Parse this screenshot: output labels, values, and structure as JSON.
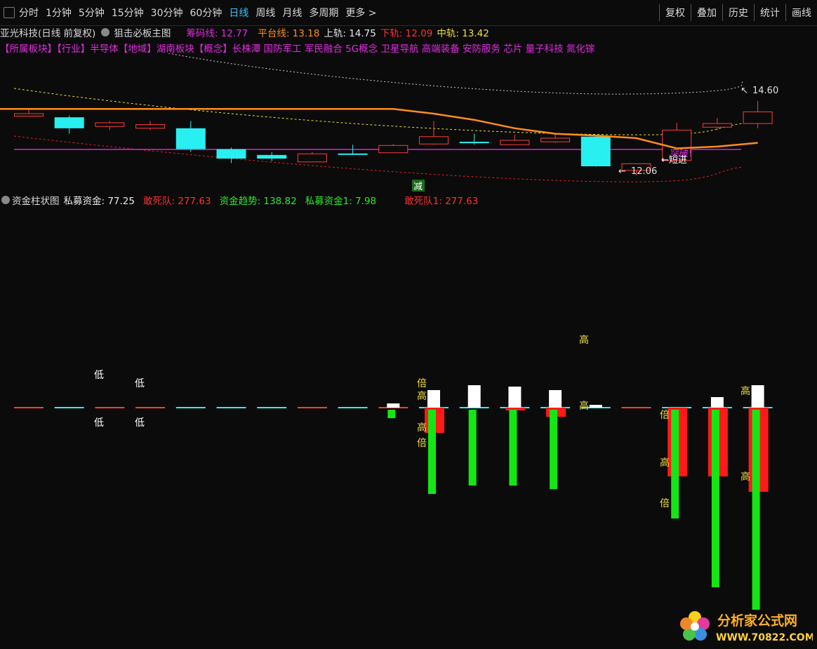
{
  "toolbar": {
    "periods": [
      "分时",
      "1分钟",
      "5分钟",
      "15分钟",
      "30分钟",
      "60分钟",
      "日线",
      "周线",
      "月线",
      "多周期",
      "更多 >"
    ],
    "active_period": "日线",
    "right_buttons": [
      "复权",
      "叠加",
      "历史",
      "统计",
      "画线"
    ]
  },
  "main_header": {
    "stock": "亚光科技(日线 前复权)",
    "indicator": "狙击必板主图",
    "chouma_label": "筹码线: 12.77",
    "pingtai_label": "平台线: 13.18",
    "shanggui_label": "上轨: 14.75",
    "xiagui_label": "下轨: 12.09",
    "zhonggui_label": "中轨: 13.42"
  },
  "blocks": [
    "【所属板块】【行业】半导体【地域】湖南板块【概念】长株潭 国防军工 军民融合 5G概念 卫星导航 高端装备 安防服务 芯片 量子科技 氮化镓"
  ],
  "sub_header": {
    "title": "资金柱状图",
    "simu_label": "私募资金: 77.25",
    "gansidui_label": "敢死队: 277.63",
    "qushi_label": "资金趋势: 138.82",
    "simu1_label": "私募资金1: 7.98",
    "gansidui1_label": "敢死队1: 277.63"
  },
  "chart_data": [
    {
      "type": "candlestick",
      "title": "",
      "price_range": [
        11.6,
        15.4
      ],
      "candles": [
        {
          "o": 13.75,
          "h": 13.85,
          "l": 13.7,
          "c": 13.68,
          "color": "red"
        },
        {
          "o": 13.65,
          "h": 13.7,
          "l": 13.2,
          "c": 13.35,
          "color": "cyan"
        },
        {
          "o": 13.4,
          "h": 13.55,
          "l": 13.3,
          "c": 13.5,
          "color": "red"
        },
        {
          "o": 13.35,
          "h": 13.55,
          "l": 13.3,
          "c": 13.45,
          "color": "red"
        },
        {
          "o": 13.35,
          "h": 13.55,
          "l": 12.7,
          "c": 12.78,
          "color": "cyan"
        },
        {
          "o": 12.78,
          "h": 12.82,
          "l": 12.4,
          "c": 12.52,
          "color": "cyan"
        },
        {
          "o": 12.62,
          "h": 12.7,
          "l": 12.45,
          "c": 12.52,
          "color": "cyan"
        },
        {
          "o": 12.43,
          "h": 12.7,
          "l": 12.43,
          "c": 12.65,
          "color": "red"
        },
        {
          "o": 12.66,
          "h": 12.9,
          "l": 12.62,
          "c": 12.66,
          "color": "cyan"
        },
        {
          "o": 12.68,
          "h": 12.92,
          "l": 12.68,
          "c": 12.88,
          "color": "red"
        },
        {
          "o": 12.92,
          "h": 13.55,
          "l": 12.9,
          "c": 13.12,
          "color": "red"
        },
        {
          "o": 12.98,
          "h": 13.2,
          "l": 12.9,
          "c": 12.95,
          "color": "cyan"
        },
        {
          "o": 12.9,
          "h": 13.18,
          "l": 12.9,
          "c": 13.02,
          "color": "red"
        },
        {
          "o": 12.98,
          "h": 13.2,
          "l": 12.95,
          "c": 13.08,
          "color": "red"
        },
        {
          "o": 13.12,
          "h": 13.12,
          "l": 12.3,
          "c": 12.31,
          "color": "cyan"
        },
        {
          "o": 12.2,
          "h": 12.38,
          "l": 12.06,
          "c": 12.38,
          "color": "red"
        },
        {
          "o": 12.47,
          "h": 13.5,
          "l": 12.47,
          "c": 13.3,
          "color": "red"
        },
        {
          "o": 13.38,
          "h": 13.63,
          "l": 13.3,
          "c": 13.48,
          "color": "red"
        },
        {
          "o": 13.48,
          "h": 14.1,
          "l": 13.35,
          "c": 13.8,
          "color": "red"
        }
      ],
      "lines": {
        "platform": [
          13.88,
          13.88,
          13.88,
          13.88,
          13.88,
          13.88,
          13.88,
          13.88,
          13.88,
          13.88,
          13.75,
          13.58,
          13.35,
          13.2,
          13.15,
          13.08,
          12.8,
          12.85,
          12.95
        ],
        "chouma": 12.77
      },
      "annotations": [
        "14.60",
        "12.06",
        "减",
        "突破!",
        "短进"
      ]
    },
    {
      "type": "bar",
      "title": "",
      "series": [
        {
          "name": "私募资金",
          "values": [
            0,
            0,
            0,
            0,
            0,
            0,
            0,
            0,
            0,
            6,
            25,
            32,
            30,
            25,
            4,
            0,
            0,
            15,
            32
          ]
        },
        {
          "name": "敢死队",
          "values": [
            0,
            0,
            0,
            0,
            0,
            0,
            0,
            0,
            0,
            0,
            -36,
            0,
            -4,
            -13,
            0,
            0,
            -98,
            -98,
            -120
          ]
        },
        {
          "name": "私募资金1",
          "values": [
            0,
            0,
            0,
            0,
            0,
            0,
            0,
            0,
            0,
            -12,
            -120,
            -108,
            -108,
            -113,
            0,
            0,
            -155,
            -253,
            -285
          ]
        }
      ],
      "markers": [
        "低",
        "低",
        "低",
        "低",
        "倍",
        "高",
        "高",
        "倍",
        "高",
        "高",
        "倍",
        "高",
        "倍",
        "高",
        "高"
      ]
    }
  ],
  "logo": {
    "name": "分析家公式网",
    "url": "WWW.70822.COM"
  }
}
